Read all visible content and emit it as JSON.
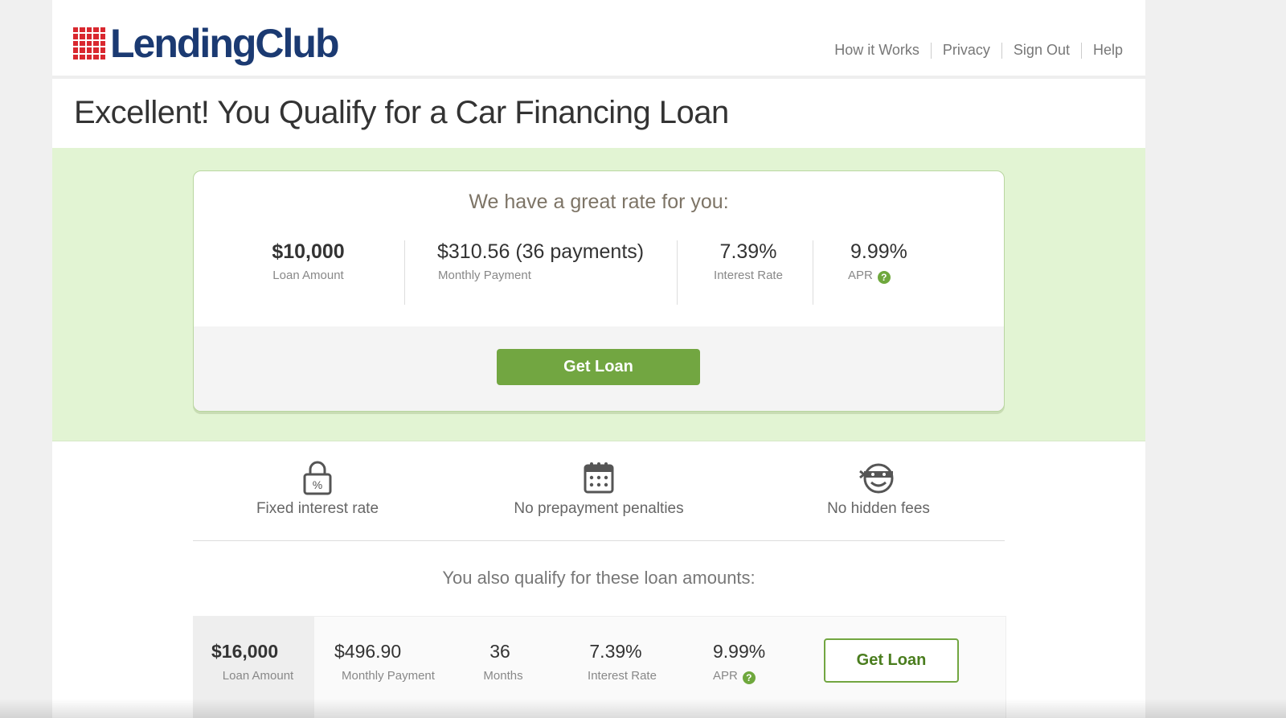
{
  "header": {
    "logo_text": "LendingClub",
    "nav": [
      "How it Works",
      "Privacy",
      "Sign Out",
      "Help"
    ]
  },
  "page_title": "Excellent! You Qualify for a Car Financing Loan",
  "offer": {
    "heading": "We have a great rate for you:",
    "loan_amount": "$10,000",
    "loan_amount_label": "Loan Amount",
    "monthly_payment": "$310.56 (36 payments)",
    "monthly_payment_label": "Monthly Payment",
    "interest_rate": "7.39%",
    "interest_rate_label": "Interest Rate",
    "apr": "9.99%",
    "apr_label": "APR",
    "help_glyph": "?",
    "button_label": "Get Loan"
  },
  "features": [
    {
      "label": "Fixed interest rate",
      "icon": "lock-percent-icon"
    },
    {
      "label": "No prepayment penalties",
      "icon": "calendar-icon"
    },
    {
      "label": "No hidden fees",
      "icon": "bandit-face-icon"
    }
  ],
  "also_heading": "You also qualify for these loan amounts:",
  "alt_offer": {
    "loan_amount": "$16,000",
    "loan_amount_label": "Loan Amount",
    "monthly_payment": "$496.90",
    "monthly_payment_label": "Monthly Payment",
    "months": "36",
    "months_label": "Months",
    "interest_rate": "7.39%",
    "interest_rate_label": "Interest Rate",
    "apr": "9.99%",
    "apr_label": "APR",
    "help_glyph": "?",
    "button_label": "Get Loan"
  },
  "colors": {
    "brand_red": "#d9282f",
    "brand_navy": "#1b3a72",
    "accent_green": "#72a641",
    "banner_green": "#e2f4d3"
  }
}
